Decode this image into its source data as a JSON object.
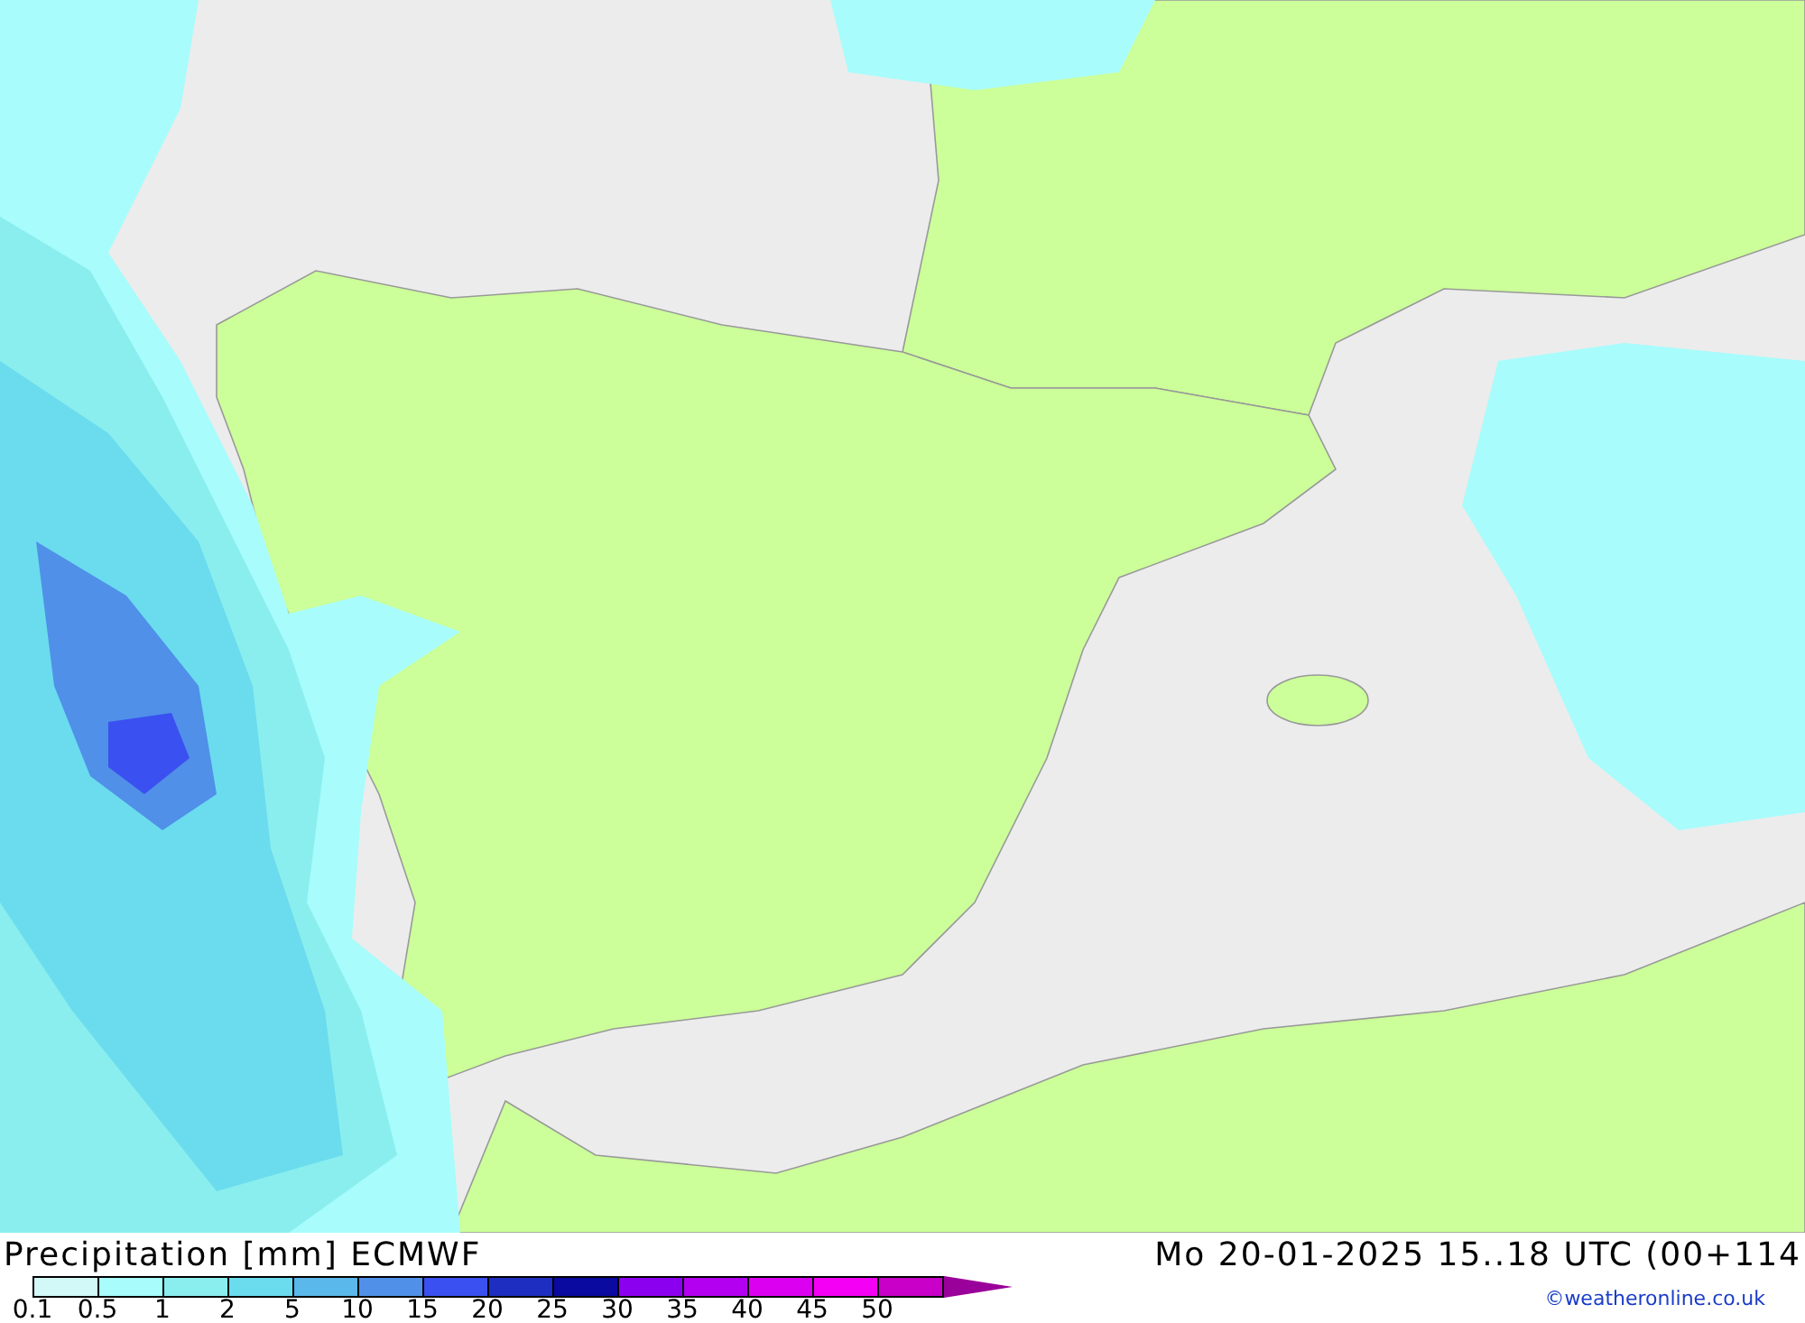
{
  "map": {
    "title": "Precipitation [mm] ECMWF",
    "valid_time": "Mo 20-01-2025 15..18 UTC (00+114",
    "credit": "©weatheronline.co.uk"
  },
  "legend": {
    "swatches": [
      {
        "color": "#d2f8f8"
      },
      {
        "color": "#a8fcfc"
      },
      {
        "color": "#8aeeee"
      },
      {
        "color": "#6adcee"
      },
      {
        "color": "#5ab8ea"
      },
      {
        "color": "#5090e8"
      },
      {
        "color": "#3a50f0"
      },
      {
        "color": "#1e2ec0"
      },
      {
        "color": "#0a0aa0"
      },
      {
        "color": "#8c00f0"
      },
      {
        "color": "#b400f0"
      },
      {
        "color": "#dc00f0"
      },
      {
        "color": "#f400f4"
      },
      {
        "color": "#c800c8"
      }
    ],
    "labels": [
      "0.1",
      "0.5",
      "1",
      "2",
      "5",
      "10",
      "15",
      "20",
      "25",
      "30",
      "35",
      "40",
      "45",
      "50"
    ]
  }
}
